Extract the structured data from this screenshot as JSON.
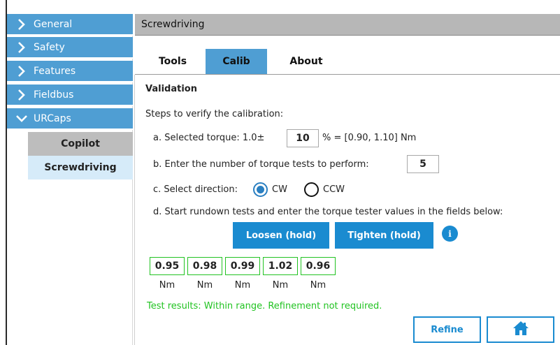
{
  "sidebar": {
    "items": [
      {
        "label": "General",
        "chevron": "chevron-right-icon"
      },
      {
        "label": "Safety",
        "chevron": "chevron-right-icon"
      },
      {
        "label": "Features",
        "chevron": "chevron-right-icon"
      },
      {
        "label": "Fieldbus",
        "chevron": "chevron-right-icon"
      },
      {
        "label": "URCaps",
        "chevron": "chevron-down-icon",
        "expanded": true
      }
    ],
    "subitems": [
      {
        "label": "Copilot",
        "selected": false
      },
      {
        "label": "Screwdriving",
        "selected": true
      }
    ]
  },
  "header": {
    "title": "Screwdriving"
  },
  "tabs": [
    {
      "label": "Tools",
      "active": false
    },
    {
      "label": "Calib",
      "active": true
    },
    {
      "label": "About",
      "active": false
    }
  ],
  "validation": {
    "heading": "Validation",
    "intro": "Steps to verify the calibration:",
    "step_a_prefix": "a. Selected torque: 1.0±",
    "step_a_value": "10",
    "step_a_suffix": "% = [0.90, 1.10] Nm",
    "step_b_label": "b. Enter the number of torque tests to perform:",
    "step_b_value": "5",
    "step_c_label": "c. Select direction:",
    "direction_options": [
      "CW",
      "CCW"
    ],
    "direction_selected": "CW",
    "step_d_label": "d. Start rundown tests and enter the torque tester values in the fields below:",
    "loosen_label": "Loosen (hold)",
    "tighten_label": "Tighten (hold)",
    "info_label": "i",
    "values": [
      "0.95",
      "0.98",
      "0.99",
      "1.02",
      "0.96"
    ],
    "unit": "Nm",
    "result_text": "Test results: Within range. Refinement not required.",
    "refine_label": "Refine"
  },
  "colors": {
    "accent": "#4f9ed3",
    "button": "#1a8bd0",
    "ok_green": "#22c322",
    "header_gray": "#b7b7b7"
  }
}
